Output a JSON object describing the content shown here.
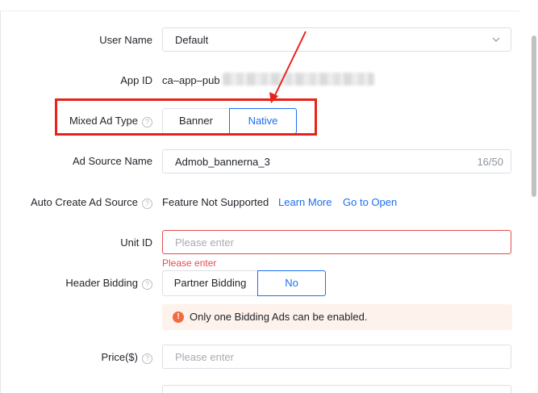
{
  "form": {
    "user_name": {
      "label": "User Name",
      "value": "Default"
    },
    "app_id": {
      "label": "App ID",
      "value": "ca–app–pub"
    },
    "mixed_ad_type": {
      "label": "Mixed Ad Type",
      "options": [
        "Banner",
        "Native"
      ],
      "selected": "Native"
    },
    "ad_source_name": {
      "label": "Ad Source Name",
      "value": "Admob_bannerna_3",
      "counter": "16/50"
    },
    "auto_create": {
      "label": "Auto Create Ad Source",
      "value": "Feature Not Supported",
      "learn_more": "Learn More",
      "go_to_open": "Go to Open"
    },
    "unit_id": {
      "label": "Unit ID",
      "placeholder": "Please enter",
      "error": "Please enter"
    },
    "header_bidding": {
      "label": "Header Bidding",
      "options": [
        "Partner Bidding",
        "No"
      ],
      "selected": "No",
      "alert": "Only one Bidding Ads can be enabled."
    },
    "price": {
      "label": "Price($)",
      "placeholder": "Please enter"
    }
  },
  "icons": {
    "help": "question-circle-icon",
    "chevron": "chevron-down-icon",
    "warning": "warning-circle-icon"
  },
  "colors": {
    "accent": "#1d6ef2",
    "error": "#e34d4d",
    "annotation": "#e8221a",
    "alert_bg": "#fdf2ec",
    "alert_icon": "#f16b3f"
  }
}
